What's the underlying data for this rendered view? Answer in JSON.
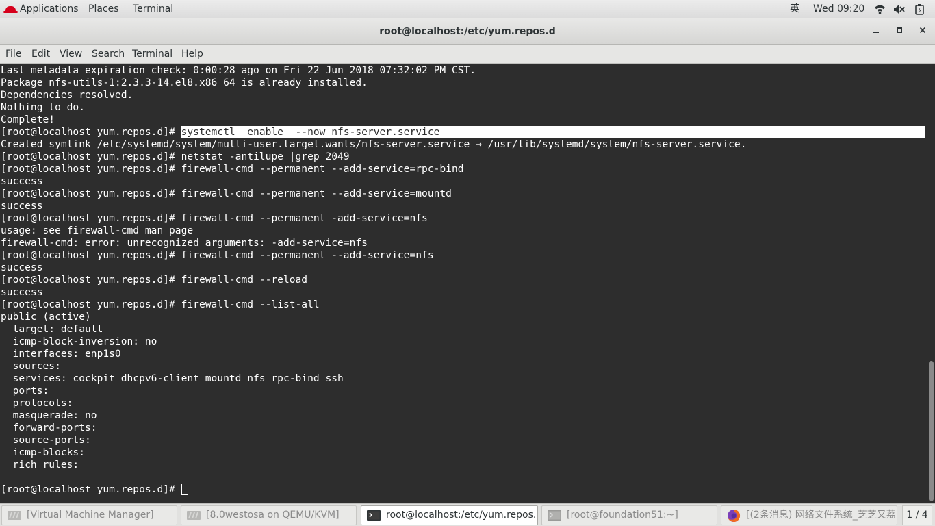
{
  "topbar": {
    "applications": "Applications",
    "places": "Places",
    "terminal": "Terminal",
    "input_method": "英",
    "clock": "Wed 09:20"
  },
  "window": {
    "title": "root@localhost:/etc/yum.repos.d"
  },
  "menu": {
    "file": "File",
    "edit": "Edit",
    "view": "View",
    "search": "Search",
    "terminal": "Terminal",
    "help": "Help"
  },
  "terminal": {
    "lines": [
      "Last metadata expiration check: 0:00:28 ago on Fri 22 Jun 2018 07:32:02 PM CST.",
      "Package nfs-utils-1:2.3.3-14.el8.x86_64 is already installed.",
      "Dependencies resolved.",
      "Nothing to do.",
      "Complete!",
      "",
      "Created symlink /etc/systemd/system/multi-user.target.wants/nfs-server.service → /usr/lib/systemd/system/nfs-server.service.",
      "[root@localhost yum.repos.d]# netstat -antilupe |grep 2049",
      "[root@localhost yum.repos.d]# firewall-cmd --permanent --add-service=rpc-bind",
      "success",
      "[root@localhost yum.repos.d]# firewall-cmd --permanent --add-service=mountd",
      "success",
      "[root@localhost yum.repos.d]# firewall-cmd --permanent -add-service=nfs",
      "usage: see firewall-cmd man page",
      "firewall-cmd: error: unrecognized arguments: -add-service=nfs",
      "[root@localhost yum.repos.d]# firewall-cmd --permanent --add-service=nfs",
      "success",
      "[root@localhost yum.repos.d]# firewall-cmd --reload",
      "success",
      "[root@localhost yum.repos.d]# firewall-cmd --list-all",
      "public (active)",
      "  target: default",
      "  icmp-block-inversion: no",
      "  interfaces: enp1s0",
      "  sources: ",
      "  services: cockpit dhcpv6-client mountd nfs rpc-bind ssh",
      "  ports: ",
      "  protocols: ",
      "  masquerade: no",
      "  forward-ports: ",
      "  source-ports: ",
      "  icmp-blocks: ",
      "  rich rules: ",
      "",
      ""
    ],
    "highlight_prompt": "[root@localhost yum.repos.d]# ",
    "highlight_command": "systemctl  enable  --now nfs-server.service",
    "final_prompt": "[root@localhost yum.repos.d]# "
  },
  "taskbar": {
    "items": [
      "[Virtual Machine Manager]",
      "[8.0westosa on QEMU/KVM]",
      "root@localhost:/etc/yum.repos.d",
      "[root@foundation51:~]",
      "[(2条消息) 网络文件系统_芝芝又荔..."
    ],
    "pager": "1 / 4"
  },
  "colors": {
    "terminal_bg": "#2d2d2d",
    "terminal_fg": "#ffffff",
    "redhat_red": "#d6001c"
  }
}
